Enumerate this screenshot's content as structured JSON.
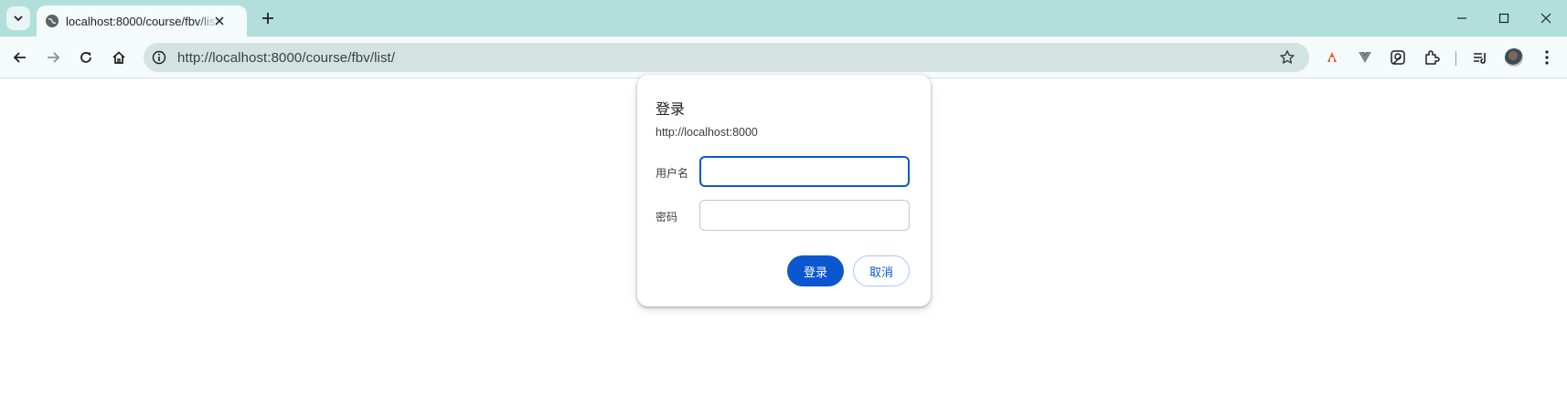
{
  "browser": {
    "tab": {
      "title": "localhost:8000/course/fbv/list/",
      "icon": "globe-icon"
    },
    "address_bar": {
      "url": "http://localhost:8000/course/fbv/list/"
    }
  },
  "login_dialog": {
    "title": "登录",
    "origin": "http://localhost:8000",
    "username_label": "用户名",
    "username_value": "",
    "password_label": "密码",
    "password_value": "",
    "submit_label": "登录",
    "cancel_label": "取消"
  },
  "colors": {
    "tabstrip": "#b2dfdc",
    "toolbar": "#f4fbfa",
    "accent": "#0b57d0"
  }
}
